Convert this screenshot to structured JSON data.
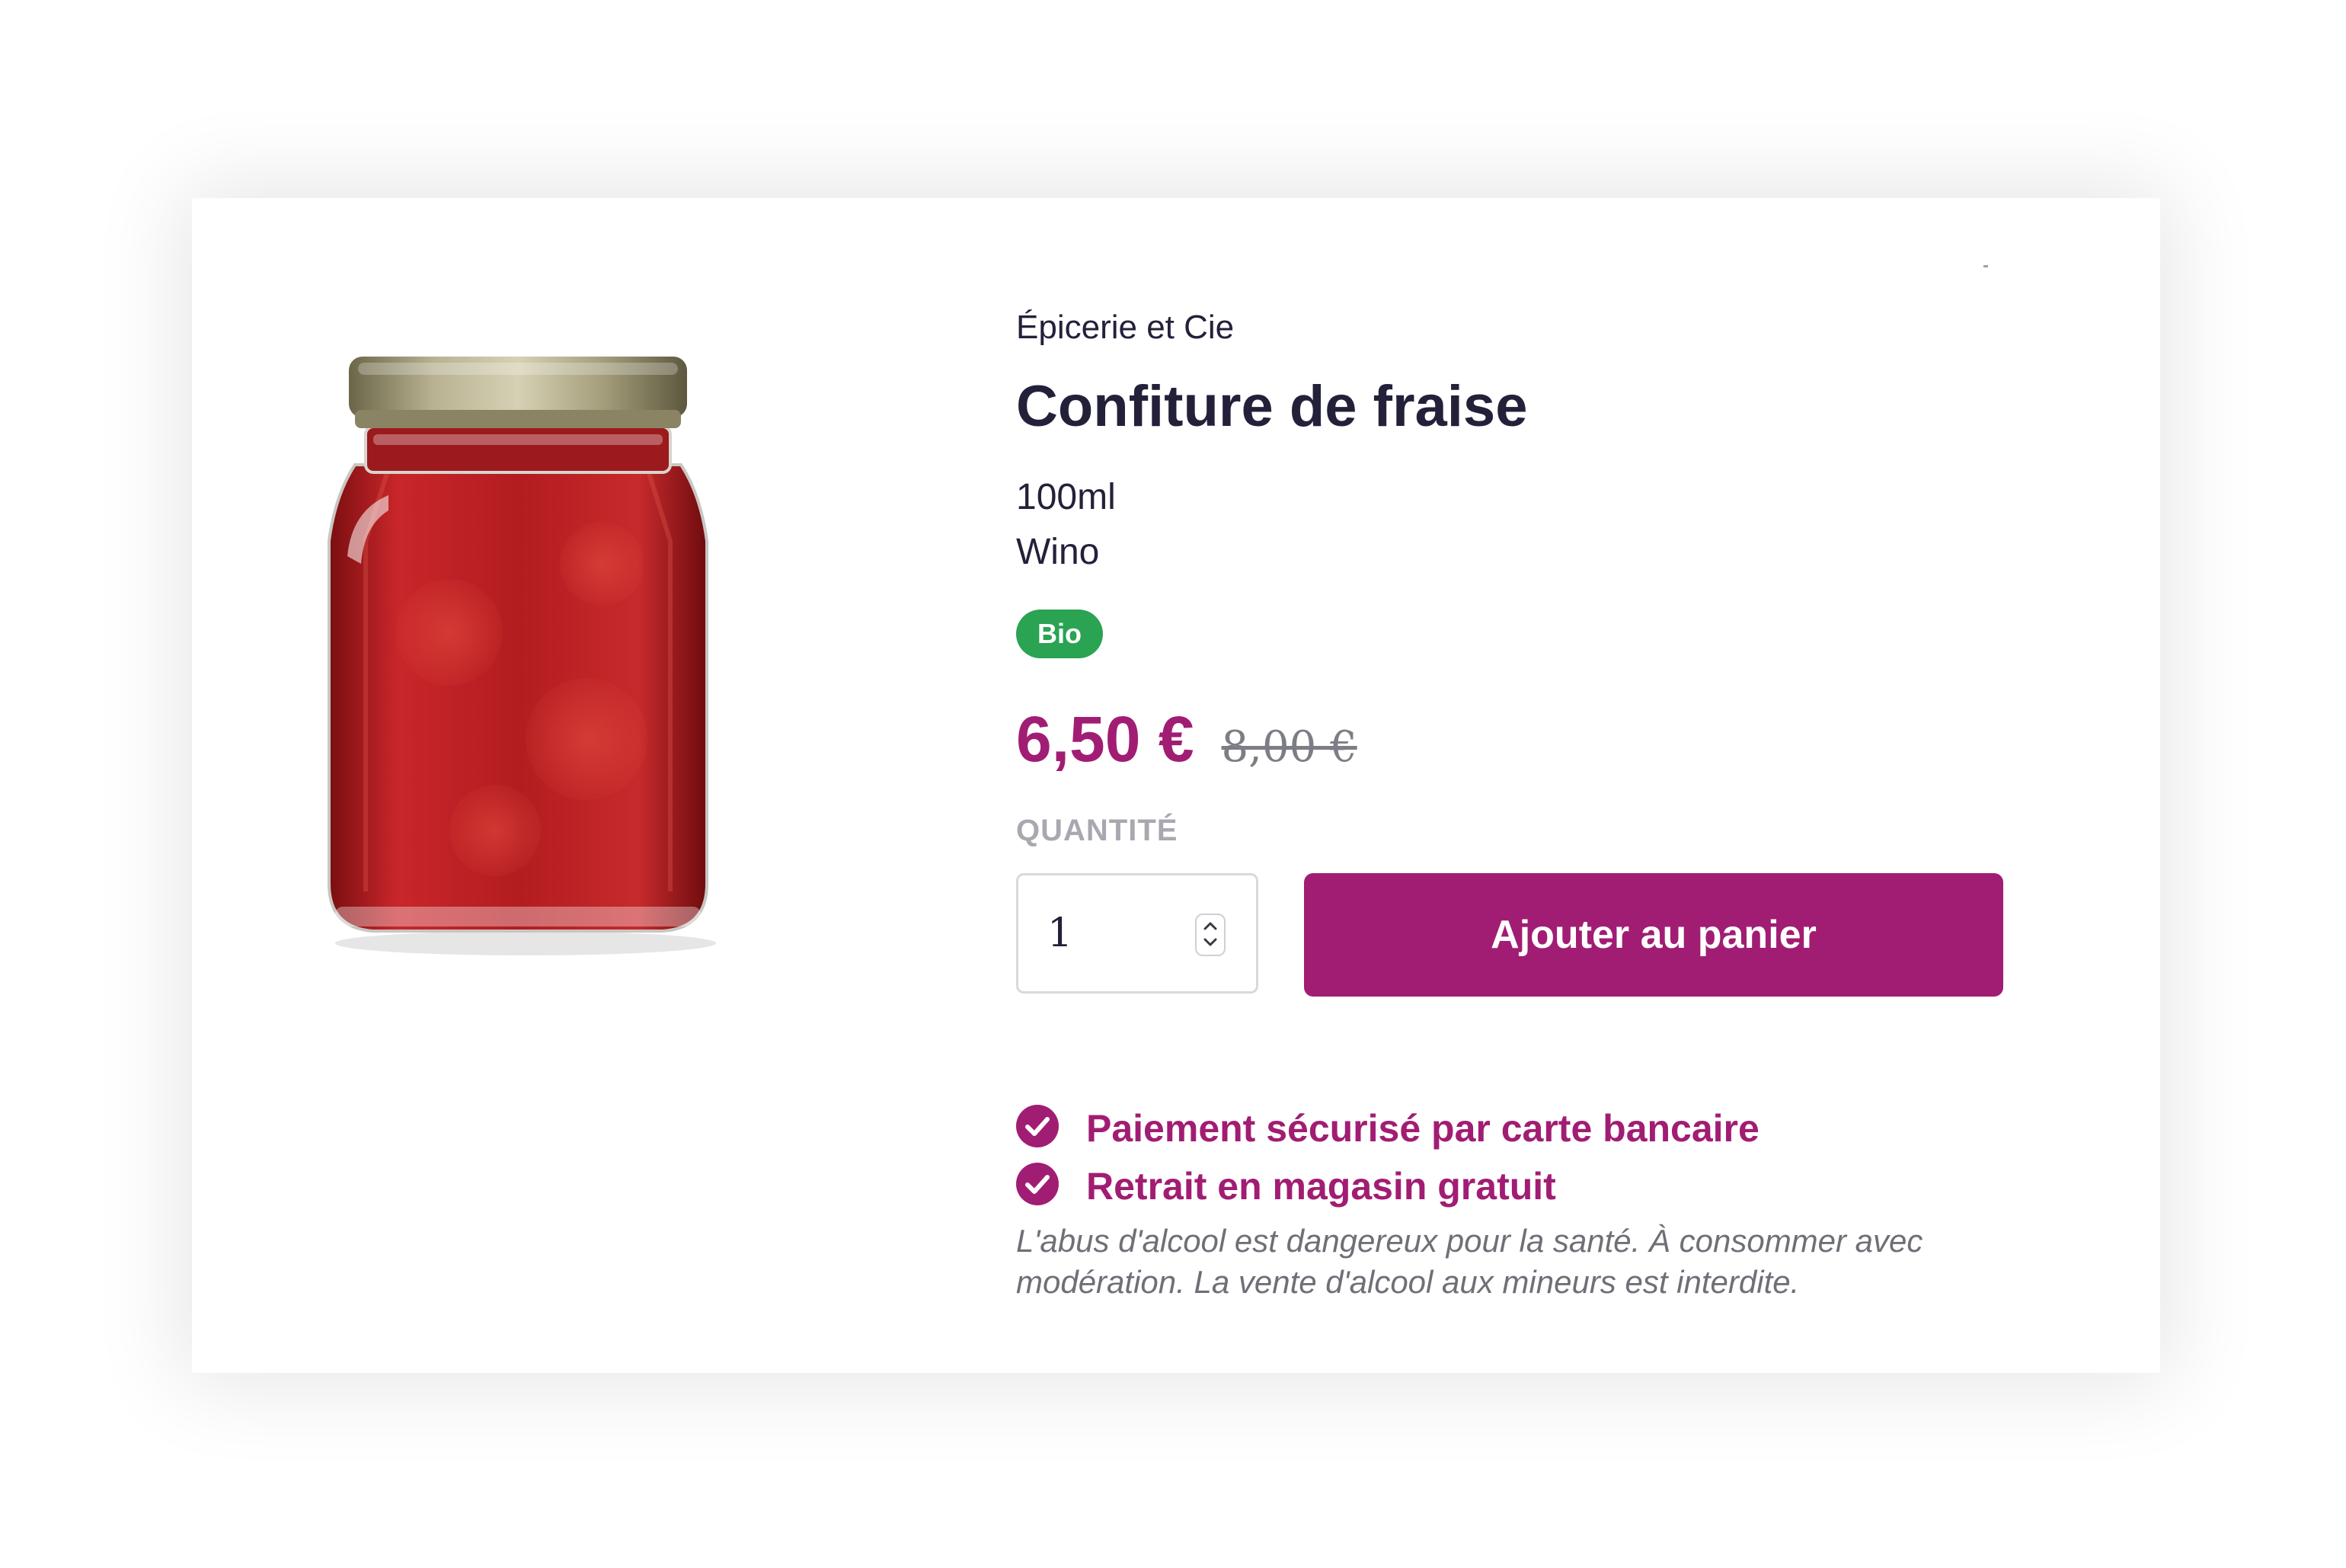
{
  "product": {
    "vendor": "Épicerie et Cie",
    "title": "Confiture de fraise",
    "size": "100ml",
    "brand": "Wino",
    "badge": "Bio",
    "price": "6,50 €",
    "compare_price": "8,00 €"
  },
  "purchase": {
    "quantity_label": "QUANTITÉ",
    "quantity_value": "1",
    "add_to_cart_label": "Ajouter au panier"
  },
  "features": [
    "Paiement sécurisé par carte bancaire",
    "Retrait en magasin gratuit"
  ],
  "disclaimer": "L'abus d'alcool est dangereux pour la santé. À consommer avec modération. La vente d'alcool aux mineurs est interdite.",
  "icons": {
    "feature_icon": "check-circle-icon",
    "stepper_up": "chevron-up-icon",
    "stepper_down": "chevron-down-icon"
  },
  "colors": {
    "accent": "#a11d73",
    "badge": "#2aa352",
    "text": "#23213a",
    "muted": "#a9a8b0"
  }
}
